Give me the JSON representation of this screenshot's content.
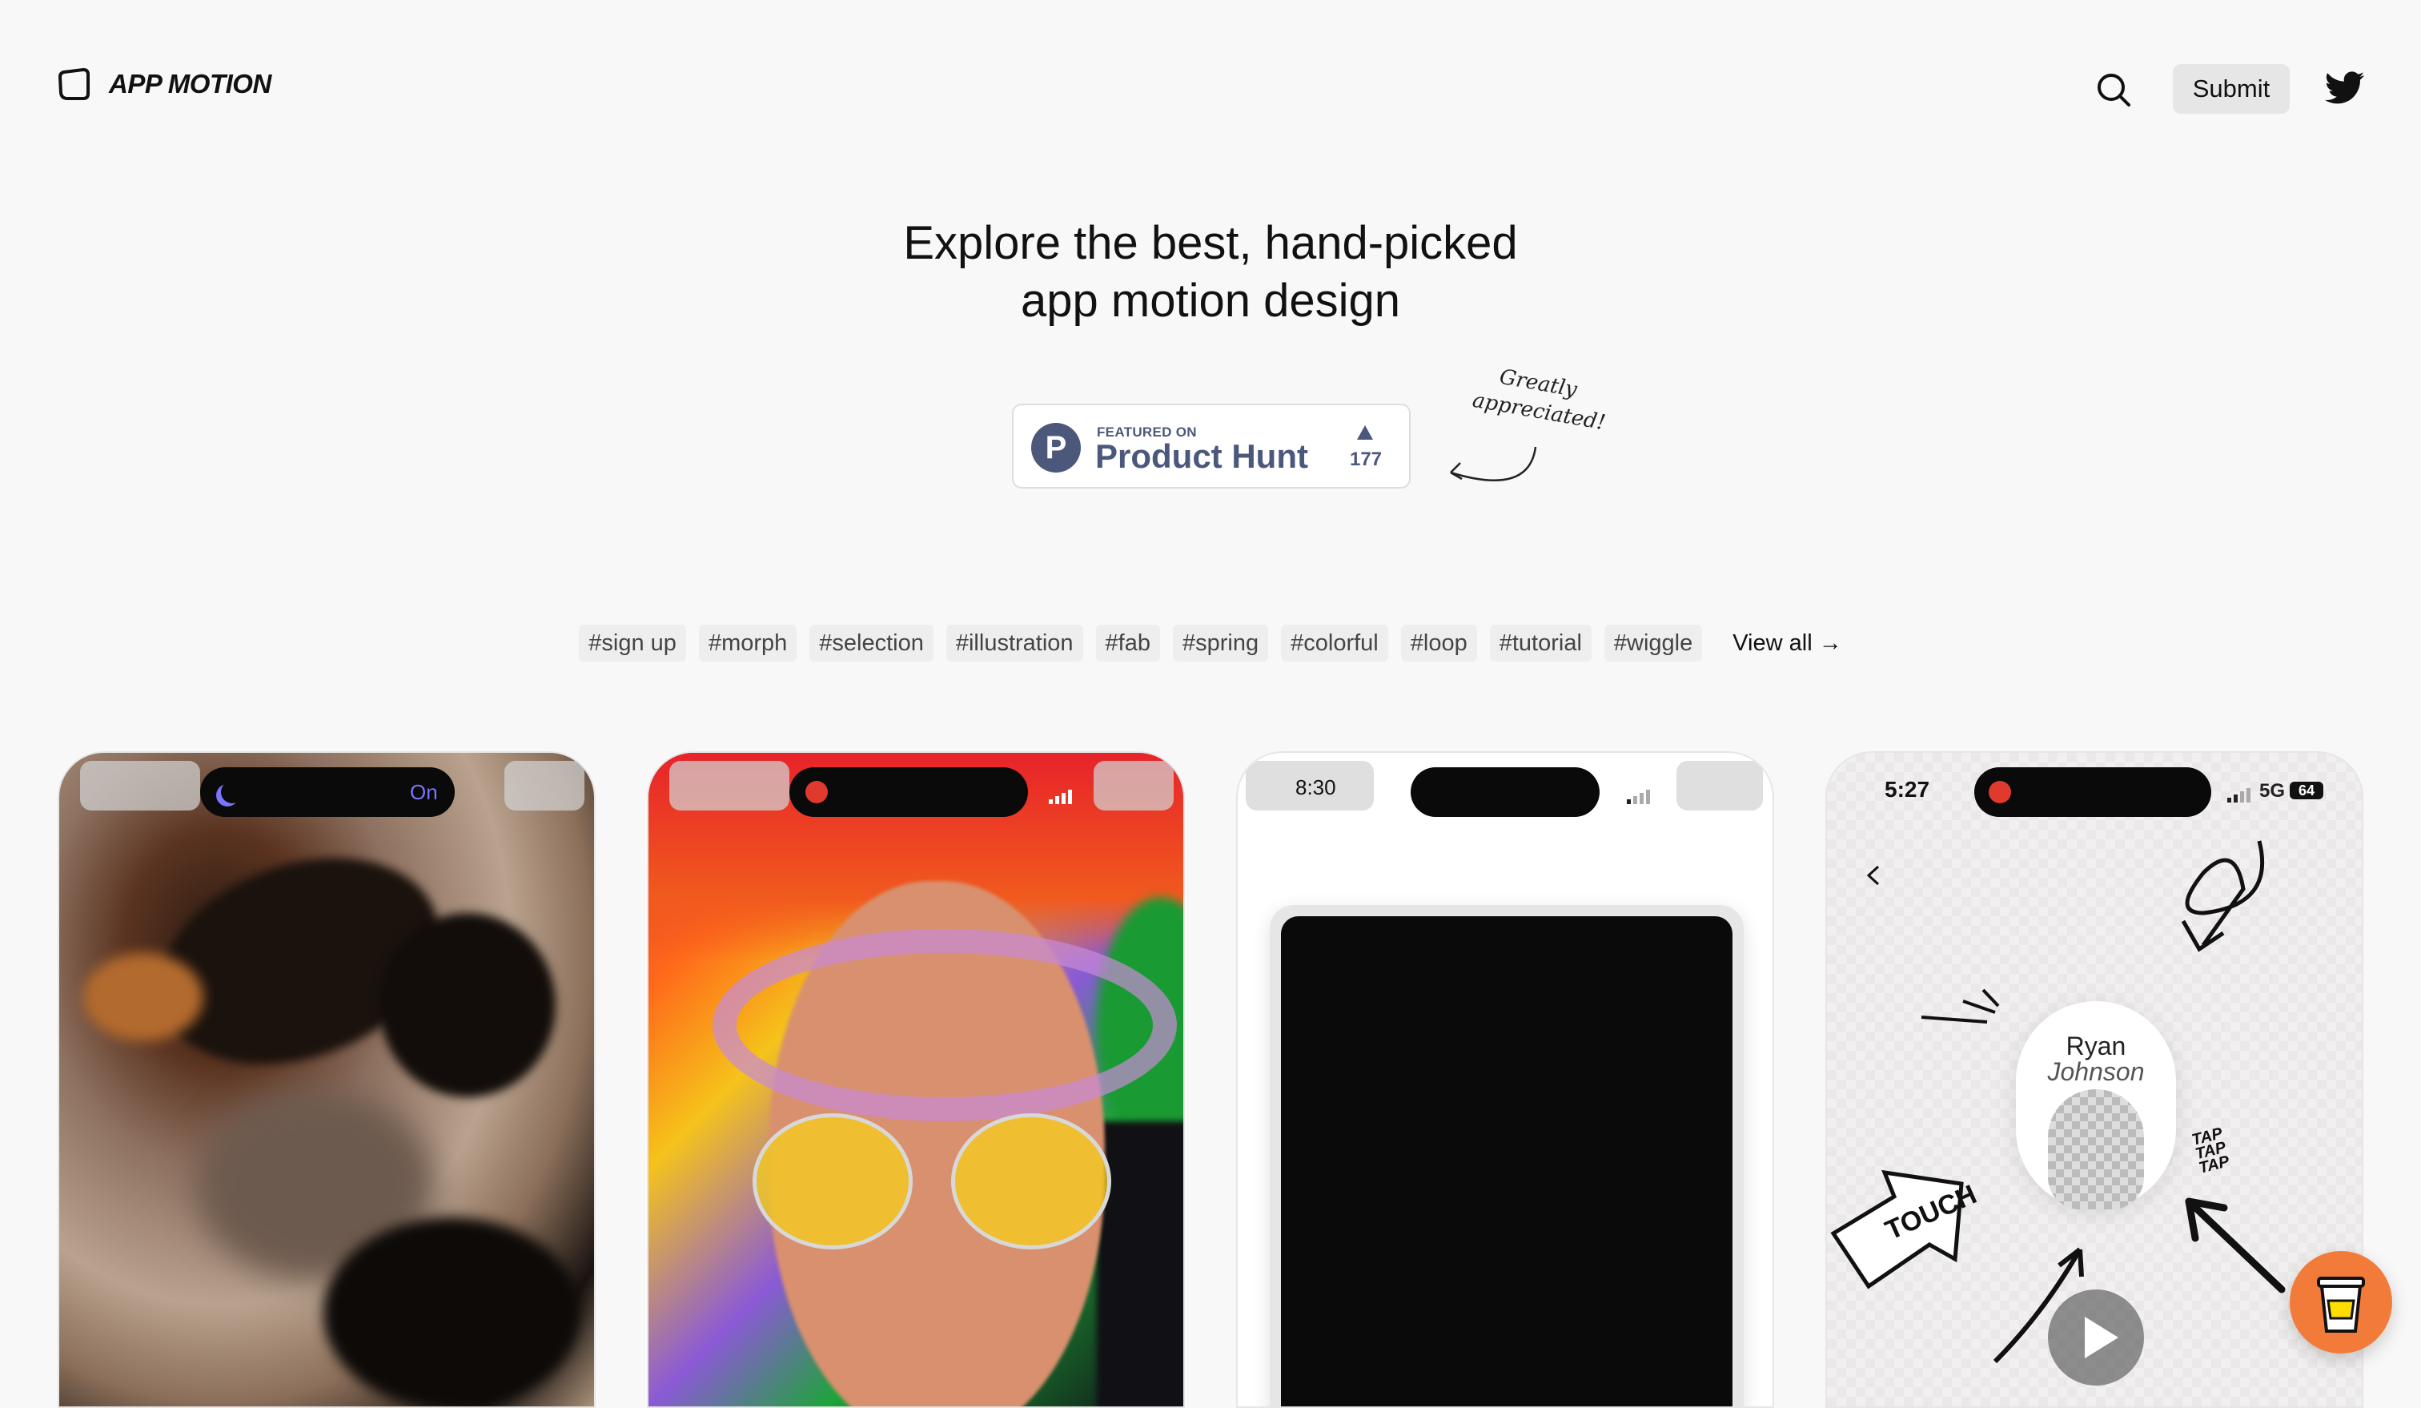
{
  "header": {
    "logo_text": "APP MOTION",
    "submit_label": "Submit"
  },
  "hero": {
    "line1": "Explore the best, hand-picked",
    "line2": "app motion design"
  },
  "product_hunt": {
    "featured": "FEATURED ON",
    "name": "Product Hunt",
    "logo_letter": "P",
    "votes": "177"
  },
  "handnote": {
    "line1": "Greatly",
    "line2": "appreciated!"
  },
  "tags": [
    "#sign up",
    "#morph",
    "#selection",
    "#illustration",
    "#fab",
    "#spring",
    "#colorful",
    "#loop",
    "#tutorial",
    "#wiggle"
  ],
  "view_all": "View all →",
  "cards": [
    {
      "status_on": "On"
    },
    {},
    {
      "time": "8:30"
    },
    {
      "time": "5:27",
      "network": "5G",
      "battery": "64",
      "first_name": "Ryan",
      "last_name": "Johnson",
      "tap_words": [
        "TAP",
        "TAP",
        "TAP"
      ],
      "touch": "TOUCH"
    }
  ],
  "colors": {
    "background": "#f8f8f8",
    "product_hunt": "#4b587c",
    "coffee_button": "#f37b3a",
    "record_dot": "#e03a2f",
    "focus_on": "#7b74ff"
  },
  "icons": [
    "app-motion-logo-icon",
    "search-icon",
    "twitter-icon",
    "product-hunt-arrow-icon",
    "back-chevron-icon",
    "play-icon",
    "coffee-cup-icon"
  ]
}
